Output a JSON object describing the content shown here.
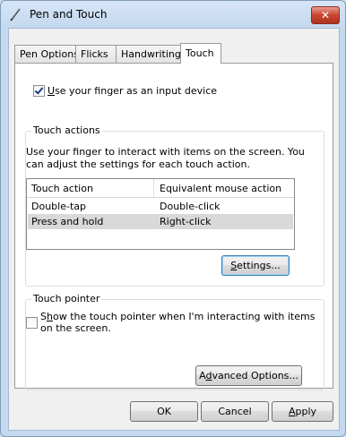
{
  "window": {
    "title": "Pen and Touch",
    "close_label": "✕"
  },
  "tabs": [
    {
      "label": "Pen Options",
      "active": false
    },
    {
      "label": "Flicks",
      "active": false
    },
    {
      "label": "Handwriting",
      "active": false
    },
    {
      "label": "Touch",
      "active": true
    }
  ],
  "finger_input": {
    "checked": true,
    "label_u": "U",
    "label_rest": "se your finger as an input device"
  },
  "touch_actions": {
    "title": "Touch actions",
    "desc_line1": "Use your finger to interact with items on the screen. You",
    "desc_line2": "can adjust the settings for each touch action.",
    "columns": [
      "Touch action",
      "Equivalent mouse action"
    ],
    "rows": [
      {
        "action": "Double-tap",
        "mouse": "Double-click",
        "selected": false
      },
      {
        "action": "Press and hold",
        "mouse": "Right-click",
        "selected": true
      }
    ],
    "settings_u": "S",
    "settings_rest": "ettings..."
  },
  "touch_pointer": {
    "title": "Touch pointer",
    "checked": false,
    "line1_pre": "S",
    "line1_u": "h",
    "line1_rest": "ow the touch pointer when I'm interacting with items",
    "line2": "on the screen.",
    "advanced_pre": "A",
    "advanced_u": "d",
    "advanced_rest": "vanced Options..."
  },
  "footer": {
    "ok": "OK",
    "cancel": "Cancel",
    "apply_u": "A",
    "apply_rest": "pply"
  }
}
